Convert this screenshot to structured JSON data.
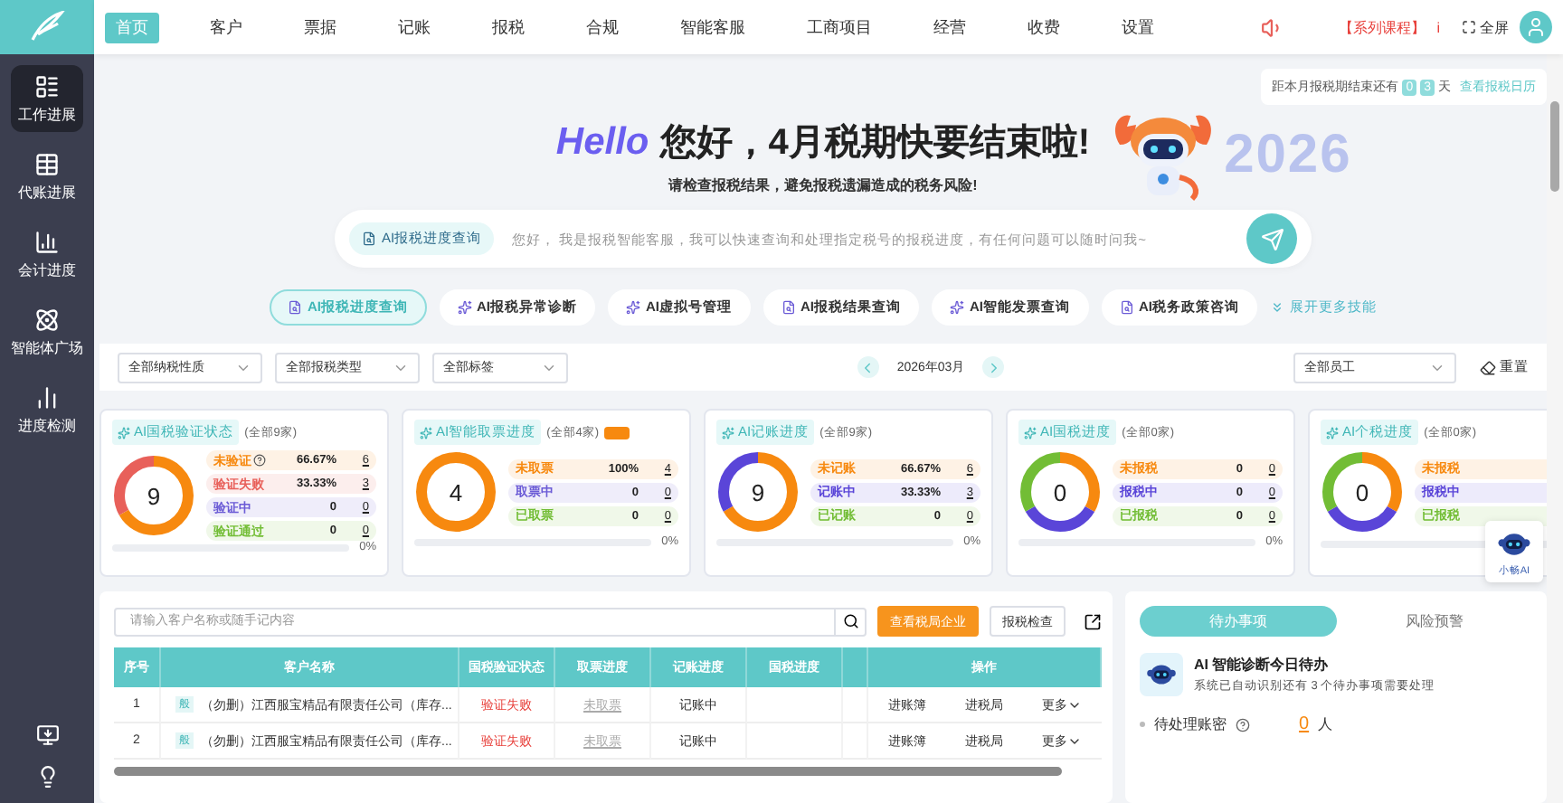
{
  "nav": {
    "items": [
      {
        "label": "首页",
        "selected": true
      },
      {
        "label": "客户",
        "selected": false
      },
      {
        "label": "票据",
        "selected": false
      },
      {
        "label": "记账",
        "selected": false
      },
      {
        "label": "报税",
        "selected": false
      },
      {
        "label": "合规",
        "selected": false
      },
      {
        "label": "智能客服",
        "selected": false
      },
      {
        "label": "工商项目",
        "selected": false
      },
      {
        "label": "经营",
        "selected": false
      },
      {
        "label": "收费",
        "selected": false
      },
      {
        "label": "设置",
        "selected": false
      }
    ],
    "course_link": "【系列课程】",
    "info_mark": "i",
    "fullscreen": "全屏"
  },
  "sidebar": {
    "items": [
      {
        "label": "工作进展",
        "selected": true
      },
      {
        "label": "代账进展",
        "selected": false
      },
      {
        "label": "会计进度",
        "selected": false
      },
      {
        "label": "智能体广场",
        "selected": false
      },
      {
        "label": "进度检测",
        "selected": false
      }
    ]
  },
  "hero": {
    "greeting": "Hello",
    "headline": "您好，4月税期快要结束啦!",
    "subtitle": "请检查报税结果，避免报税遗漏造成的税务风险!",
    "year": "2026",
    "countdown": {
      "prefix": "距本月报税期结束还有",
      "digits": [
        "0",
        "3"
      ],
      "unit": "天",
      "link": "查看报税日历"
    }
  },
  "assistant": {
    "chip": "AI报税进度查询",
    "placeholder": "您好， 我是报税智能客服，我可以快速查询和处理指定税号的报税进度，有任何问题可以随时问我~"
  },
  "skills": {
    "items": [
      {
        "label": "AI报税进度查询",
        "selected": true
      },
      {
        "label": "AI报税异常诊断",
        "selected": false
      },
      {
        "label": "AI虚拟号管理",
        "selected": false
      },
      {
        "label": "AI报税结果查询",
        "selected": false
      },
      {
        "label": "AI智能发票查询",
        "selected": false
      },
      {
        "label": "AI税务政策咨询",
        "selected": false
      }
    ],
    "more": "展开更多技能"
  },
  "filters": {
    "selects": [
      "全部纳税性质",
      "全部报税类型",
      "全部标签"
    ],
    "month": "2026年03月",
    "staff": "全部员工",
    "reset": "重置"
  },
  "cards": [
    {
      "title": "AI国税验证状态",
      "scope": "(全部9家)",
      "total": "9",
      "badge": false,
      "level": 0,
      "reading": "0%",
      "rows": [
        {
          "label": "未验证",
          "help": true,
          "percent": "66.67%",
          "count": "6",
          "color": "#f7890f"
        },
        {
          "label": "验证失败",
          "help": false,
          "percent": "33.33%",
          "count": "3",
          "color": "#e8605a"
        },
        {
          "label": "验证中",
          "help": false,
          "percent": "0",
          "count": "0",
          "color": "#6b5bd6"
        },
        {
          "label": "验证通过",
          "help": false,
          "percent": "0",
          "count": "0",
          "color": "#72bd35"
        }
      ]
    },
    {
      "title": "AI智能取票进度",
      "scope": "(全部4家)",
      "total": "4",
      "badge": true,
      "level": 0,
      "reading": "0%",
      "rows": [
        {
          "label": "未取票",
          "percent": "100%",
          "count": "4",
          "color": "#f7890f"
        },
        {
          "label": "取票中",
          "percent": "0",
          "count": "0",
          "color": "#6b5bd6"
        },
        {
          "label": "已取票",
          "percent": "0",
          "count": "0",
          "color": "#72bd35"
        }
      ]
    },
    {
      "title": "AI记账进度",
      "scope": "(全部9家)",
      "total": "9",
      "badge": false,
      "level": 0,
      "reading": "0%",
      "rows": [
        {
          "label": "未记账",
          "percent": "66.67%",
          "count": "6",
          "color": "#f7890f"
        },
        {
          "label": "记账中",
          "percent": "33.33%",
          "count": "3",
          "color": "#5a45d8"
        },
        {
          "label": "已记账",
          "percent": "0",
          "count": "0",
          "color": "#72bd35"
        }
      ]
    },
    {
      "title": "AI国税进度",
      "scope": "(全部0家)",
      "total": "0",
      "badge": false,
      "level": 0,
      "reading": "0%",
      "rows": [
        {
          "label": "未报税",
          "percent": "0",
          "count": "0",
          "color": "#f7890f"
        },
        {
          "label": "报税中",
          "percent": "0",
          "count": "0",
          "color": "#5a45d8"
        },
        {
          "label": "已报税",
          "percent": "0",
          "count": "0",
          "color": "#72bd35"
        }
      ]
    },
    {
      "title": "AI个税进度",
      "scope": "(全部0家)",
      "total": "0",
      "badge": false,
      "level": 0,
      "rows": [
        {
          "label": "未报税",
          "color": "#f7890f"
        },
        {
          "label": "报税中",
          "color": "#5a45d8"
        },
        {
          "label": "已报税",
          "color": "#72bd35"
        }
      ]
    }
  ],
  "table": {
    "search_placeholder": "请输入客户名称或随手记内容",
    "buttons": [
      {
        "label": "查看税局企业",
        "kind": "primary"
      },
      {
        "label": "报税检查",
        "kind": "outline"
      }
    ],
    "columns": [
      "序号",
      "客户名称",
      "国税验证状态",
      "取票进度",
      "记账进度",
      "国税进度",
      "操作"
    ],
    "rows": [
      {
        "index": "1",
        "tag": "般",
        "name": "（勿删）江西服宝精品有限责任公司（库存...",
        "verify": "验证失败",
        "ticket": "未取票",
        "bookkeeping": "记账中",
        "actions": [
          "进账簿",
          "进税局"
        ],
        "more": "更多"
      },
      {
        "index": "2",
        "tag": "般",
        "name": "（勿删）江西服宝精品有限责任公司（库存...",
        "verify": "验证失败",
        "ticket": "未取票",
        "bookkeeping": "记账中",
        "actions": [
          "进账簿",
          "进税局"
        ],
        "more": "更多"
      }
    ]
  },
  "todo": {
    "tabs": [
      {
        "label": "待办事项",
        "selected": true
      },
      {
        "label": "风险预警",
        "selected": false
      }
    ],
    "title": "AI 智能诊断今日待办",
    "subtitle": "系统已自动识别还有 3 个待办事项需要处理",
    "items": [
      {
        "label": "待处理账密",
        "value": "0",
        "unit": "人"
      }
    ]
  },
  "floating_assistant": {
    "label": "小畅AI"
  }
}
